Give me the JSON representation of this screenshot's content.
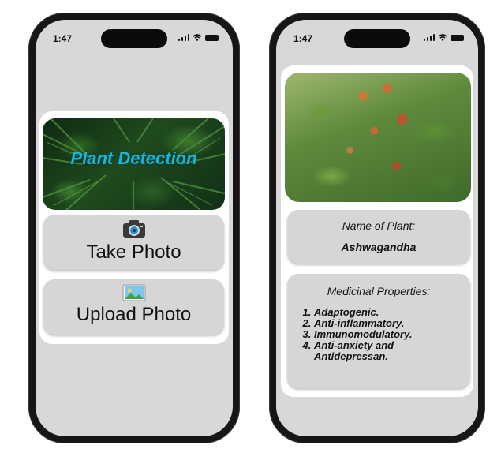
{
  "left_phone": {
    "status_time": "1:47",
    "banner_title": "Plant Detection",
    "take_photo_label": "Take Photo",
    "take_photo_icon": "camera-icon",
    "upload_photo_label": "Upload Photo",
    "upload_photo_icon": "picture-icon"
  },
  "right_phone": {
    "status_time": "1:47",
    "plant_image": "plant-photo",
    "name_heading": "Name of Plant:",
    "name_value": "Ashwagandha",
    "properties_heading": "Medicinal Properties:",
    "properties": [
      "Adaptogenic.",
      "Anti-inflammatory.",
      "Immunomodulatory.",
      "Anti-anxiety and Antidepressan."
    ]
  },
  "colors": {
    "screen_bg": "#d8d8d8",
    "pill_bg": "#d6d6d6",
    "banner_title": "#19b5d6",
    "phone_frame": "#161616"
  }
}
